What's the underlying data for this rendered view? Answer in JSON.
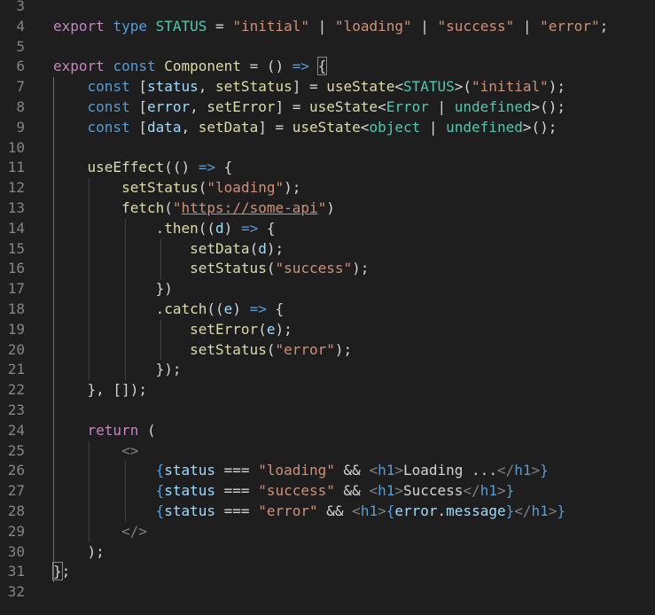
{
  "editor": {
    "language": "typescriptreact",
    "theme_colors": {
      "background": "#1e1e1e",
      "keyword": "#c586c0",
      "storage": "#569cd6",
      "type": "#4ec9b0",
      "function": "#dcdcaa",
      "variable": "#9cdcfe",
      "string": "#ce9178",
      "line_number": "#858585"
    },
    "lines": [
      {
        "num": "3",
        "tokens": []
      },
      {
        "num": "4",
        "tokens": [
          [
            "k",
            "export"
          ],
          [
            "p",
            " "
          ],
          [
            "b",
            "type"
          ],
          [
            "p",
            " "
          ],
          [
            "t",
            "STATUS"
          ],
          [
            "p",
            " = "
          ],
          [
            "s",
            "\"initial\""
          ],
          [
            "p",
            " | "
          ],
          [
            "s",
            "\"loading\""
          ],
          [
            "p",
            " | "
          ],
          [
            "s",
            "\"success\""
          ],
          [
            "p",
            " | "
          ],
          [
            "s",
            "\"error\""
          ],
          [
            "p",
            ";"
          ]
        ]
      },
      {
        "num": "5",
        "tokens": []
      },
      {
        "num": "6",
        "tokens": [
          [
            "k",
            "export"
          ],
          [
            "p",
            " "
          ],
          [
            "b",
            "const"
          ],
          [
            "p",
            " "
          ],
          [
            "f",
            "Component"
          ],
          [
            "p",
            " = () "
          ],
          [
            "b",
            "=>"
          ],
          [
            "p",
            " "
          ],
          [
            "brace",
            "{"
          ]
        ]
      },
      {
        "num": "7",
        "tokens": [
          [
            "p",
            "    "
          ],
          [
            "b",
            "const"
          ],
          [
            "p",
            " ["
          ],
          [
            "v",
            "status"
          ],
          [
            "p",
            ", "
          ],
          [
            "f",
            "setStatus"
          ],
          [
            "p",
            "] = "
          ],
          [
            "f",
            "useState"
          ],
          [
            "p",
            "<"
          ],
          [
            "t",
            "STATUS"
          ],
          [
            "p",
            ">("
          ],
          [
            "s",
            "\"initial\""
          ],
          [
            "p",
            ");"
          ]
        ]
      },
      {
        "num": "8",
        "tokens": [
          [
            "p",
            "    "
          ],
          [
            "b",
            "const"
          ],
          [
            "p",
            " ["
          ],
          [
            "v",
            "error"
          ],
          [
            "p",
            ", "
          ],
          [
            "f",
            "setError"
          ],
          [
            "p",
            "] = "
          ],
          [
            "f",
            "useState"
          ],
          [
            "p",
            "<"
          ],
          [
            "t",
            "Error"
          ],
          [
            "p",
            " | "
          ],
          [
            "t",
            "undefined"
          ],
          [
            "p",
            ">();"
          ]
        ]
      },
      {
        "num": "9",
        "tokens": [
          [
            "p",
            "    "
          ],
          [
            "b",
            "const"
          ],
          [
            "p",
            " ["
          ],
          [
            "v",
            "data"
          ],
          [
            "p",
            ", "
          ],
          [
            "f",
            "setData"
          ],
          [
            "p",
            "] = "
          ],
          [
            "f",
            "useState"
          ],
          [
            "p",
            "<"
          ],
          [
            "t",
            "object"
          ],
          [
            "p",
            " | "
          ],
          [
            "t",
            "undefined"
          ],
          [
            "p",
            ">();"
          ]
        ]
      },
      {
        "num": "10",
        "tokens": []
      },
      {
        "num": "11",
        "tokens": [
          [
            "p",
            "    "
          ],
          [
            "f",
            "useEffect"
          ],
          [
            "p",
            "(() "
          ],
          [
            "b",
            "=>"
          ],
          [
            "p",
            " {"
          ]
        ]
      },
      {
        "num": "12",
        "tokens": [
          [
            "p",
            "        "
          ],
          [
            "f",
            "setStatus"
          ],
          [
            "p",
            "("
          ],
          [
            "s",
            "\"loading\""
          ],
          [
            "p",
            ");"
          ]
        ]
      },
      {
        "num": "13",
        "tokens": [
          [
            "p",
            "        "
          ],
          [
            "f",
            "fetch"
          ],
          [
            "p",
            "("
          ],
          [
            "s",
            "\""
          ],
          [
            "su",
            "https://some-api"
          ],
          [
            "s",
            "\""
          ],
          [
            "p",
            ")"
          ]
        ]
      },
      {
        "num": "14",
        "tokens": [
          [
            "p",
            "            ."
          ],
          [
            "f",
            "then"
          ],
          [
            "p",
            "(("
          ],
          [
            "v",
            "d"
          ],
          [
            "p",
            ") "
          ],
          [
            "b",
            "=>"
          ],
          [
            "p",
            " {"
          ]
        ]
      },
      {
        "num": "15",
        "tokens": [
          [
            "p",
            "                "
          ],
          [
            "f",
            "setData"
          ],
          [
            "p",
            "("
          ],
          [
            "v",
            "d"
          ],
          [
            "p",
            ");"
          ]
        ]
      },
      {
        "num": "16",
        "tokens": [
          [
            "p",
            "                "
          ],
          [
            "f",
            "setStatus"
          ],
          [
            "p",
            "("
          ],
          [
            "s",
            "\"success\""
          ],
          [
            "p",
            ");"
          ]
        ]
      },
      {
        "num": "17",
        "tokens": [
          [
            "p",
            "            })"
          ]
        ]
      },
      {
        "num": "18",
        "tokens": [
          [
            "p",
            "            ."
          ],
          [
            "f",
            "catch"
          ],
          [
            "p",
            "(("
          ],
          [
            "v",
            "e"
          ],
          [
            "p",
            ") "
          ],
          [
            "b",
            "=>"
          ],
          [
            "p",
            " {"
          ]
        ]
      },
      {
        "num": "19",
        "tokens": [
          [
            "p",
            "                "
          ],
          [
            "f",
            "setError"
          ],
          [
            "p",
            "("
          ],
          [
            "v",
            "e"
          ],
          [
            "p",
            ");"
          ]
        ]
      },
      {
        "num": "20",
        "tokens": [
          [
            "p",
            "                "
          ],
          [
            "f",
            "setStatus"
          ],
          [
            "p",
            "("
          ],
          [
            "s",
            "\"error\""
          ],
          [
            "p",
            ");"
          ]
        ]
      },
      {
        "num": "21",
        "tokens": [
          [
            "p",
            "            });"
          ]
        ]
      },
      {
        "num": "22",
        "tokens": [
          [
            "p",
            "    }, []);"
          ]
        ]
      },
      {
        "num": "23",
        "tokens": []
      },
      {
        "num": "24",
        "tokens": [
          [
            "p",
            "    "
          ],
          [
            "k",
            "return"
          ],
          [
            "p",
            " ("
          ]
        ]
      },
      {
        "num": "25",
        "tokens": [
          [
            "p",
            "        "
          ],
          [
            "tag",
            "<>"
          ]
        ]
      },
      {
        "num": "26",
        "tokens": [
          [
            "p",
            "            "
          ],
          [
            "b",
            "{"
          ],
          [
            "v",
            "status"
          ],
          [
            "p",
            " === "
          ],
          [
            "s",
            "\"loading\""
          ],
          [
            "p",
            " && "
          ],
          [
            "tag",
            "<"
          ],
          [
            "tn",
            "h1"
          ],
          [
            "tag",
            ">"
          ],
          [
            "p",
            "Loading ..."
          ],
          [
            "tag",
            "</"
          ],
          [
            "tn",
            "h1"
          ],
          [
            "tag",
            ">"
          ],
          [
            "b",
            "}"
          ]
        ]
      },
      {
        "num": "27",
        "tokens": [
          [
            "p",
            "            "
          ],
          [
            "b",
            "{"
          ],
          [
            "v",
            "status"
          ],
          [
            "p",
            " === "
          ],
          [
            "s",
            "\"success\""
          ],
          [
            "p",
            " && "
          ],
          [
            "tag",
            "<"
          ],
          [
            "tn",
            "h1"
          ],
          [
            "tag",
            ">"
          ],
          [
            "p",
            "Success"
          ],
          [
            "tag",
            "</"
          ],
          [
            "tn",
            "h1"
          ],
          [
            "tag",
            ">"
          ],
          [
            "b",
            "}"
          ]
        ]
      },
      {
        "num": "28",
        "tokens": [
          [
            "p",
            "            "
          ],
          [
            "b",
            "{"
          ],
          [
            "v",
            "status"
          ],
          [
            "p",
            " === "
          ],
          [
            "s",
            "\"error\""
          ],
          [
            "p",
            " && "
          ],
          [
            "tag",
            "<"
          ],
          [
            "tn",
            "h1"
          ],
          [
            "tag",
            ">"
          ],
          [
            "b",
            "{"
          ],
          [
            "v",
            "error"
          ],
          [
            "p",
            "."
          ],
          [
            "v",
            "message"
          ],
          [
            "b",
            "}"
          ],
          [
            "tag",
            "</"
          ],
          [
            "tn",
            "h1"
          ],
          [
            "tag",
            ">"
          ],
          [
            "b",
            "}"
          ]
        ]
      },
      {
        "num": "29",
        "tokens": [
          [
            "p",
            "        "
          ],
          [
            "tag",
            "</>"
          ]
        ]
      },
      {
        "num": "30",
        "tokens": [
          [
            "p",
            "    );"
          ]
        ]
      },
      {
        "num": "31",
        "tokens": [
          [
            "brace",
            "}"
          ],
          [
            "p",
            ";"
          ]
        ]
      },
      {
        "num": "32",
        "tokens": []
      }
    ]
  }
}
